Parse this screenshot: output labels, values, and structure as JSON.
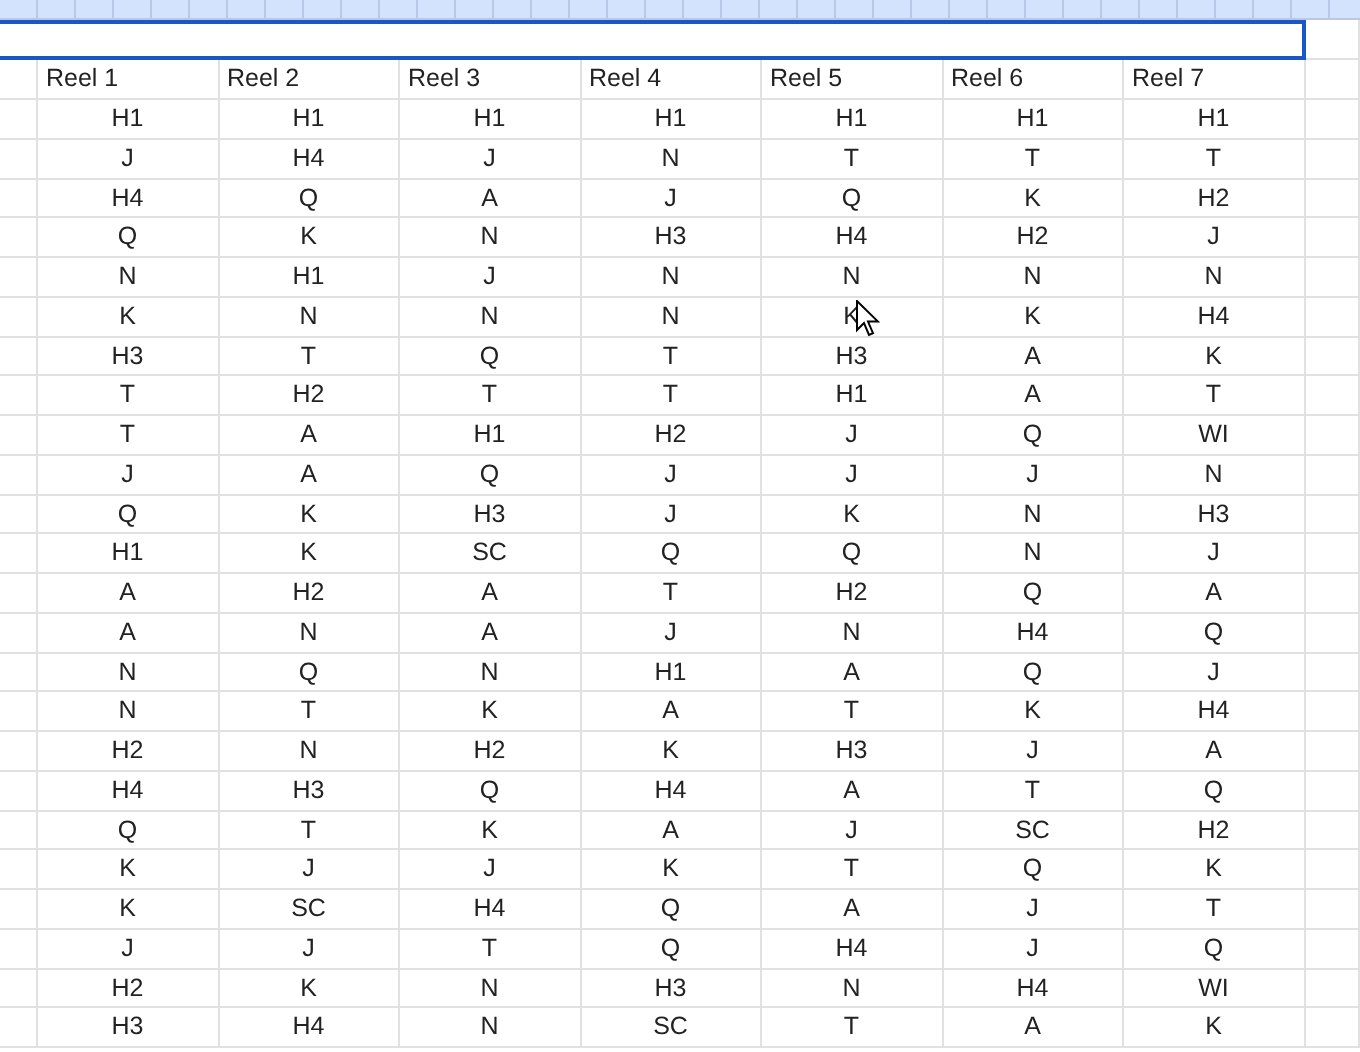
{
  "columns": [
    "Reel 1",
    "Reel 2",
    "Reel 3",
    "Reel 4",
    "Reel 5",
    "Reel 6",
    "Reel 7"
  ],
  "rows": [
    [
      "H1",
      "H1",
      "H1",
      "H1",
      "H1",
      "H1",
      "H1"
    ],
    [
      "J",
      "H4",
      "J",
      "N",
      "T",
      "T",
      "T"
    ],
    [
      "H4",
      "Q",
      "A",
      "J",
      "Q",
      "K",
      "H2"
    ],
    [
      "Q",
      "K",
      "N",
      "H3",
      "H4",
      "H2",
      "J"
    ],
    [
      "N",
      "H1",
      "J",
      "N",
      "N",
      "N",
      "N"
    ],
    [
      "K",
      "N",
      "N",
      "N",
      "K",
      "K",
      "H4"
    ],
    [
      "H3",
      "T",
      "Q",
      "T",
      "H3",
      "A",
      "K"
    ],
    [
      "T",
      "H2",
      "T",
      "T",
      "H1",
      "A",
      "T"
    ],
    [
      "T",
      "A",
      "H1",
      "H2",
      "J",
      "Q",
      "WI"
    ],
    [
      "J",
      "A",
      "Q",
      "J",
      "J",
      "J",
      "N"
    ],
    [
      "Q",
      "K",
      "H3",
      "J",
      "K",
      "N",
      "H3"
    ],
    [
      "H1",
      "K",
      "SC",
      "Q",
      "Q",
      "N",
      "J"
    ],
    [
      "A",
      "H2",
      "A",
      "T",
      "H2",
      "Q",
      "A"
    ],
    [
      "A",
      "N",
      "A",
      "J",
      "N",
      "H4",
      "Q"
    ],
    [
      "N",
      "Q",
      "N",
      "H1",
      "A",
      "Q",
      "J"
    ],
    [
      "N",
      "T",
      "K",
      "A",
      "T",
      "K",
      "H4"
    ],
    [
      "H2",
      "N",
      "H2",
      "K",
      "H3",
      "J",
      "A"
    ],
    [
      "H4",
      "H3",
      "Q",
      "H4",
      "A",
      "T",
      "Q"
    ],
    [
      "Q",
      "T",
      "K",
      "A",
      "J",
      "SC",
      "H2"
    ],
    [
      "K",
      "J",
      "J",
      "K",
      "T",
      "Q",
      "K"
    ],
    [
      "K",
      "SC",
      "H4",
      "Q",
      "A",
      "J",
      "T"
    ],
    [
      "J",
      "J",
      "T",
      "Q",
      "H4",
      "J",
      "Q"
    ],
    [
      "H2",
      "K",
      "N",
      "H3",
      "N",
      "H4",
      "WI"
    ],
    [
      "H3",
      "H4",
      "N",
      "SC",
      "T",
      "A",
      "K"
    ]
  ]
}
